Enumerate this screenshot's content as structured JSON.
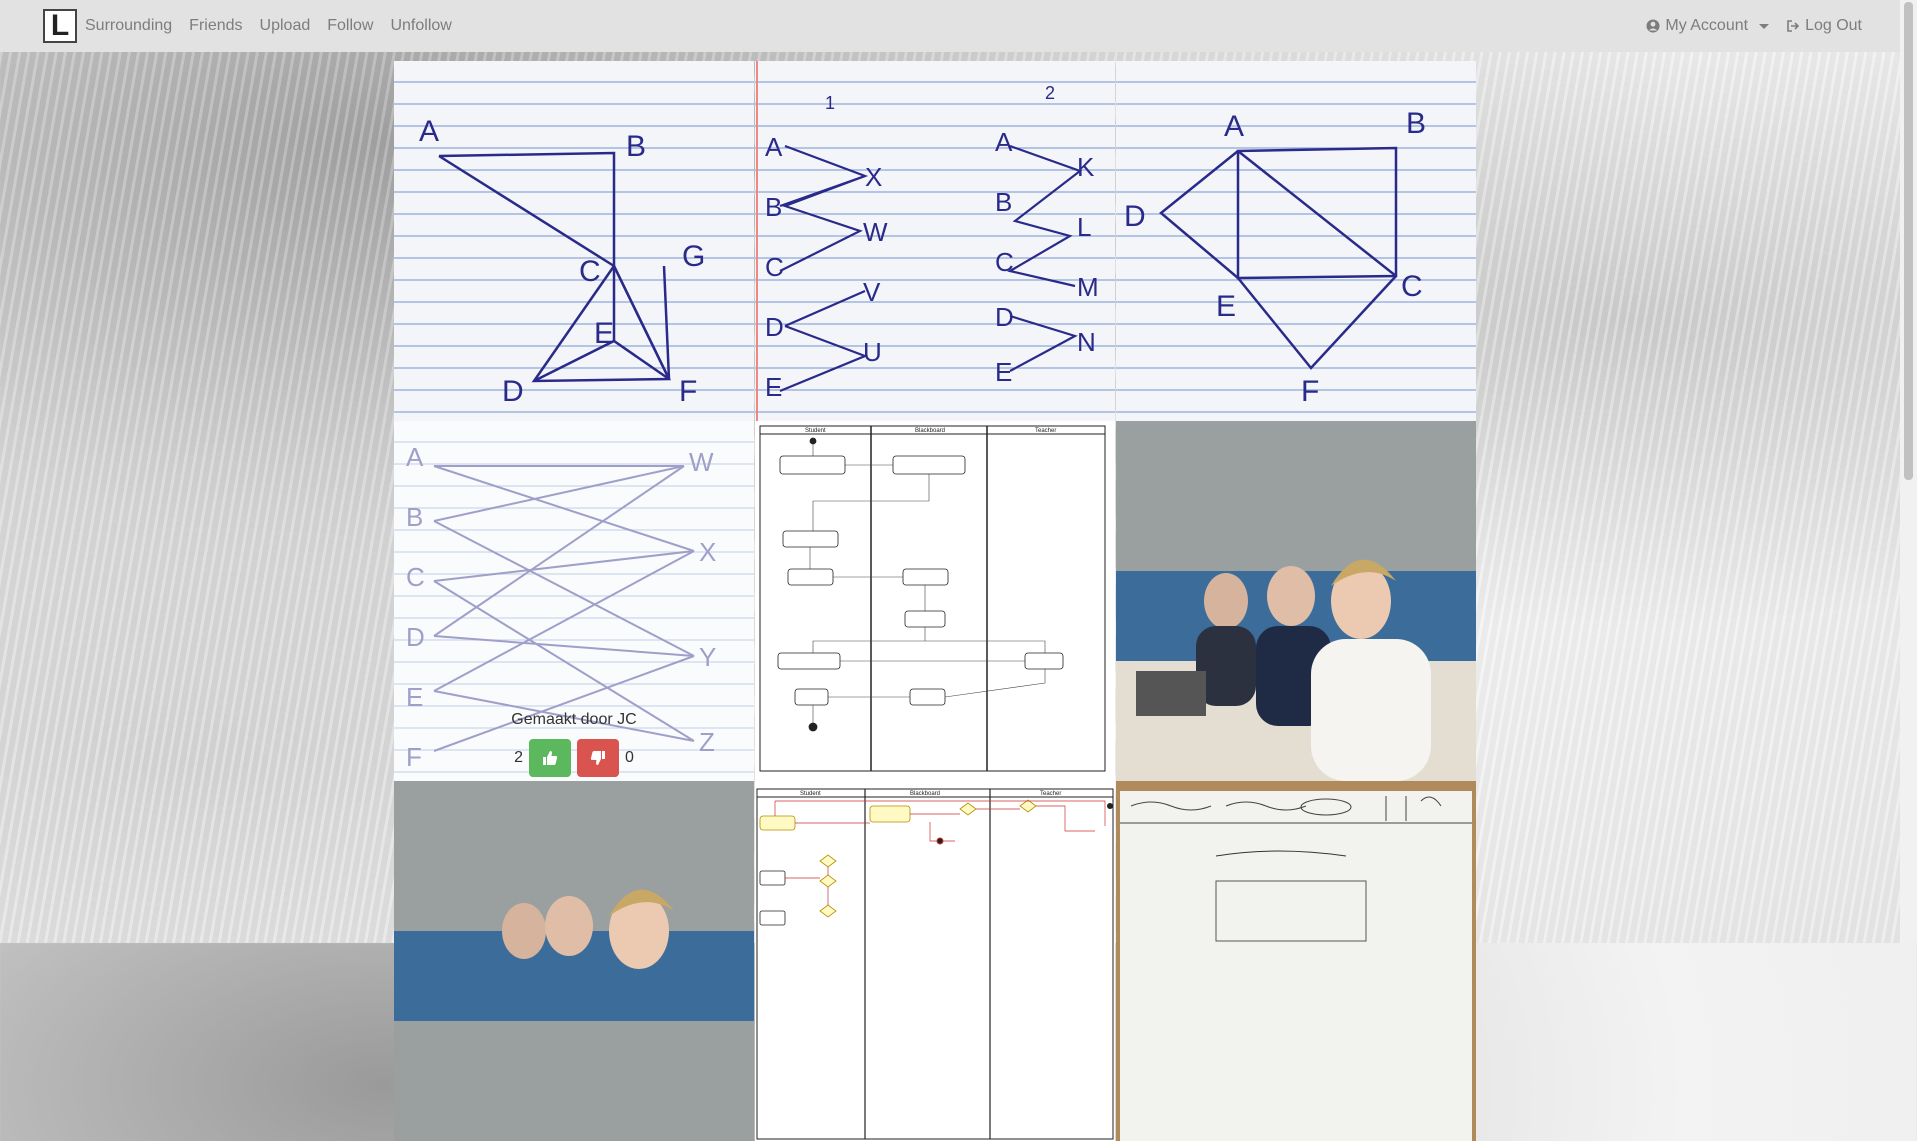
{
  "nav": {
    "logo_letter": "L",
    "links": [
      "Surrounding",
      "Friends",
      "Upload",
      "Follow",
      "Unfollow"
    ],
    "account_label": "My Account",
    "logout_label": "Log Out"
  },
  "posts": [
    {
      "type": "graph-sketch",
      "letters": [
        "A",
        "B",
        "C",
        "G",
        "E",
        "D",
        "F"
      ]
    },
    {
      "type": "bipartite-sketch",
      "left": [
        "A",
        "B",
        "C",
        "D",
        "E"
      ],
      "right1": [
        "X",
        "W",
        "V",
        "U"
      ],
      "left2": [
        "A",
        "B",
        "C",
        "D",
        "E"
      ],
      "right2": [
        "K",
        "L",
        "M",
        "N"
      ],
      "labels": [
        "1",
        "2"
      ]
    },
    {
      "type": "graph-sketch",
      "letters": [
        "A",
        "B",
        "D",
        "E",
        "C",
        "F"
      ]
    },
    {
      "type": "bipartite-sketch",
      "left": [
        "A",
        "B",
        "C",
        "D",
        "E",
        "F"
      ],
      "right": [
        "W",
        "X",
        "Y",
        "Z"
      ],
      "caption": "Gemaakt door JC",
      "likes": "2",
      "dislikes": "0"
    },
    {
      "type": "activity-diagram",
      "lanes": [
        "Student",
        "Blackboard",
        "Teacher"
      ]
    },
    {
      "type": "photo",
      "subject": "group-photo"
    },
    {
      "type": "photo",
      "subject": "group-photo"
    },
    {
      "type": "activity-diagram",
      "lanes": [
        "Student",
        "Blackboard",
        "Teacher"
      ]
    },
    {
      "type": "photo",
      "subject": "whiteboard"
    }
  ],
  "colors": {
    "like": "#5cb85c",
    "dislike": "#d9534f",
    "ink": "#2a2a8a"
  }
}
